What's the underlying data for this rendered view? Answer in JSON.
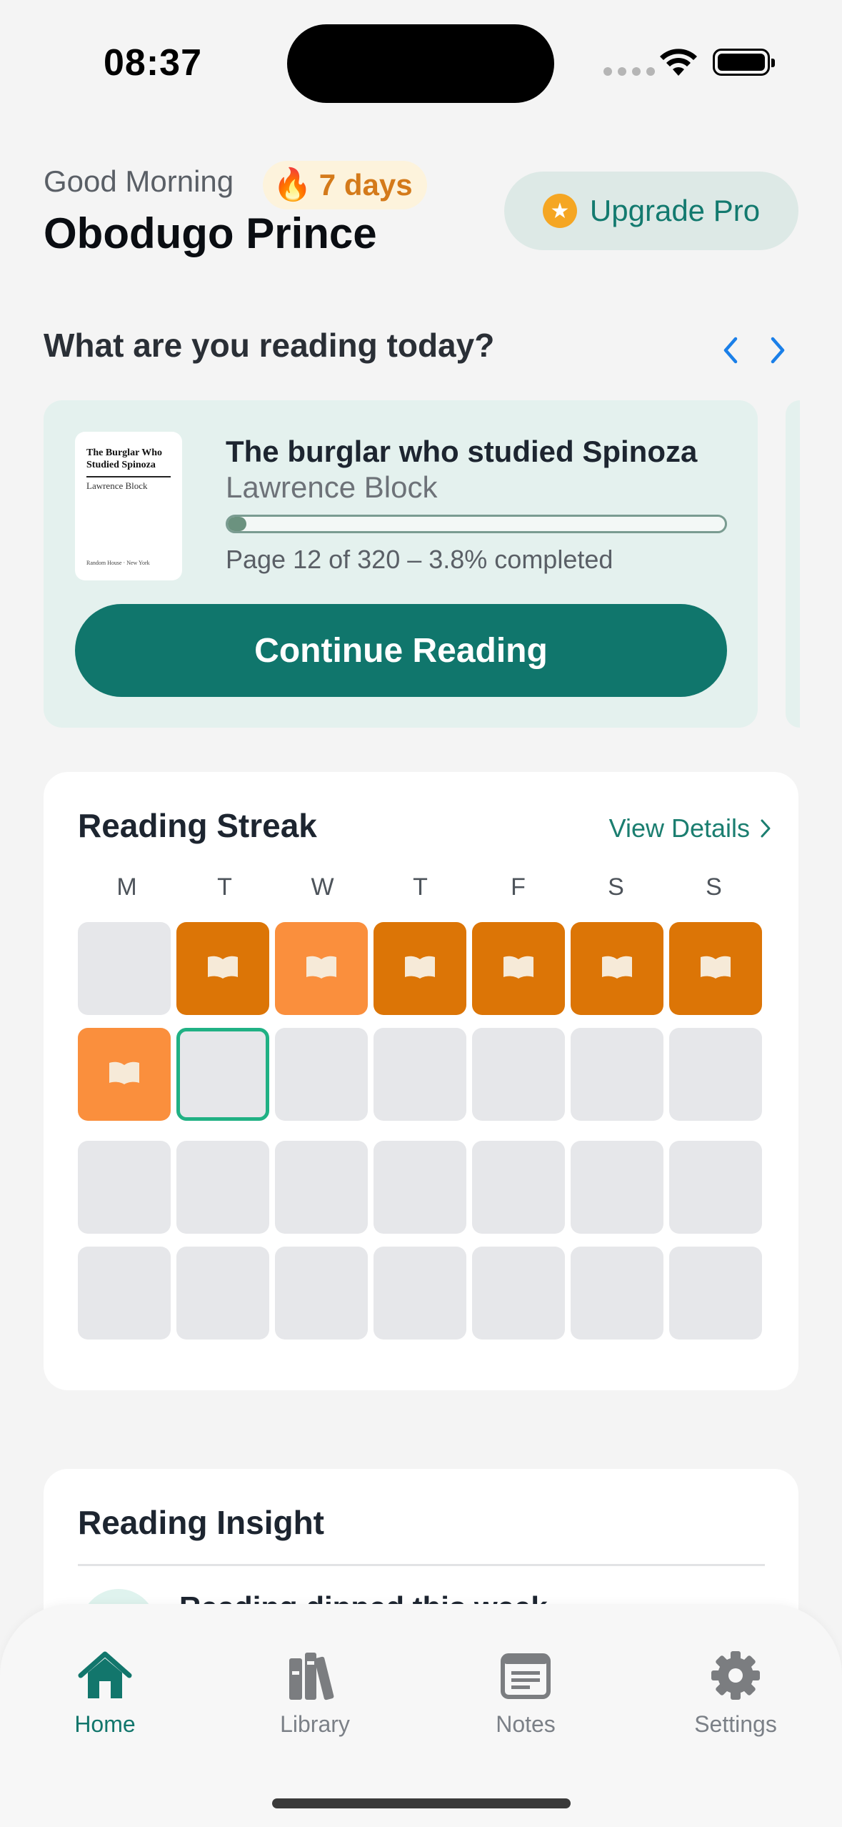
{
  "status_bar": {
    "time": "08:37"
  },
  "header": {
    "greeting": "Good Morning",
    "streak_badge": "7 days",
    "user_name": "Obodugo Prince",
    "upgrade_label": "Upgrade Pro"
  },
  "reading_today": {
    "heading": "What are you reading today?",
    "book": {
      "title": "The burglar who studied Spinoza",
      "author": "Lawrence Block",
      "cover_title": "The Burglar Who Studied Spinoza",
      "cover_author": "Lawrence Block",
      "cover_publisher": "Random House · New York",
      "progress_percent": 3.8,
      "page_info": "Page 12 of 320 – 3.8% completed"
    },
    "continue_label": "Continue Reading"
  },
  "streak": {
    "title": "Reading Streak",
    "view_details": "View Details",
    "day_labels": [
      "M",
      "T",
      "W",
      "T",
      "F",
      "S",
      "S"
    ],
    "rows": [
      [
        "empty",
        "dark",
        "light",
        "dark",
        "dark",
        "dark",
        "dark"
      ],
      [
        "light",
        "today",
        "empty",
        "empty",
        "empty",
        "empty",
        "empty"
      ],
      [
        "empty",
        "empty",
        "empty",
        "empty",
        "empty",
        "empty",
        "empty"
      ],
      [
        "empty",
        "empty",
        "empty",
        "empty",
        "empty",
        "empty",
        "empty"
      ]
    ],
    "colors": {
      "dark": "#dc7506",
      "light": "#fa8f3d",
      "today_border": "#20b184",
      "empty": "#e6e7ea"
    }
  },
  "insight": {
    "title": "Reading Insight",
    "text": "Reading dipped this week"
  },
  "tabs": [
    {
      "label": "Home",
      "icon": "home-icon",
      "active": true
    },
    {
      "label": "Library",
      "icon": "books-icon",
      "active": false
    },
    {
      "label": "Notes",
      "icon": "notes-icon",
      "active": false
    },
    {
      "label": "Settings",
      "icon": "gear-icon",
      "active": false
    }
  ],
  "theme": {
    "accent": "#10766c",
    "accent_light": "#e4f1ee",
    "streak_orange": "#d47a1a"
  }
}
